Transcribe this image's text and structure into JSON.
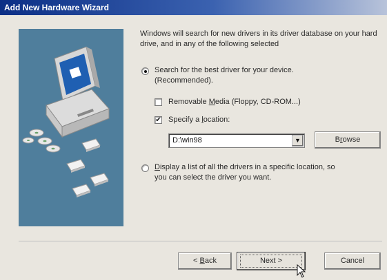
{
  "window": {
    "title": "Add New Hardware Wizard"
  },
  "intro": "Windows will search for new drivers in its driver database on your hard drive, and in any of the following selected",
  "options": {
    "search_best": {
      "line1": "Search for the best driver for your device.",
      "line2": "(Recommended).",
      "selected": true
    },
    "removable_media": {
      "prefix": "Removable ",
      "accel": "M",
      "suffix": "edia (Floppy, CD-ROM...)",
      "checked": false
    },
    "specify_location": {
      "prefix": "Specify a ",
      "accel": "l",
      "suffix": "ocation:",
      "checked": true
    },
    "location_value": "D:\\win98",
    "browse_prefix": "B",
    "browse_accel": "r",
    "browse_suffix": "owse",
    "display_list": {
      "accel": "D",
      "line1_rest": "isplay a list of all the drivers in a specific location, so",
      "line2": "you can select the driver you want.",
      "selected": false
    }
  },
  "buttons": {
    "back_prefix": "< ",
    "back_accel": "B",
    "back_suffix": "ack",
    "next": "Next >",
    "cancel": "Cancel"
  },
  "icons": {
    "computer": "computer-icon",
    "cd_disc": "cd-disc-icon",
    "floppy": "floppy-disk-icon",
    "checkmark": "✔",
    "dropdown": "▼",
    "cursor": "mouse-cursor-icon"
  },
  "colors": {
    "titlebar_start": "#0c2f86",
    "sidepanel": "#4f7e9c",
    "face": "#e9e6df"
  }
}
